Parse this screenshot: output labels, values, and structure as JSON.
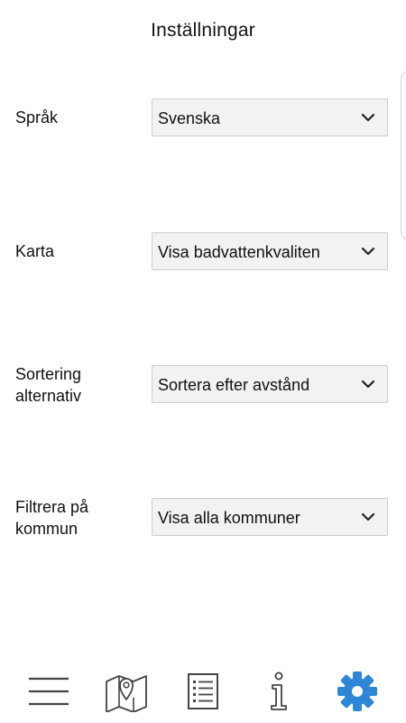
{
  "header": {
    "title": "Inställningar"
  },
  "settings": [
    {
      "label": "Språk",
      "value": "Svenska"
    },
    {
      "label": "Karta",
      "value": "Visa badvattenkvaliten"
    },
    {
      "label": "Sortering\nalternativ",
      "value": "Sortera efter avstånd"
    },
    {
      "label": "Filtrera på\nkommun",
      "value": "Visa alla kommuner"
    }
  ],
  "bottom_nav": {
    "items": [
      {
        "icon": "menu-icon",
        "active": false
      },
      {
        "icon": "map-icon",
        "active": false
      },
      {
        "icon": "list-icon",
        "active": false
      },
      {
        "icon": "info-icon",
        "active": false
      },
      {
        "icon": "gear-icon",
        "active": true
      }
    ]
  },
  "colors": {
    "accent": "#2e86d6",
    "icon": "#444444",
    "select_background": "#f2f2f2",
    "select_border": "#cccccc"
  }
}
